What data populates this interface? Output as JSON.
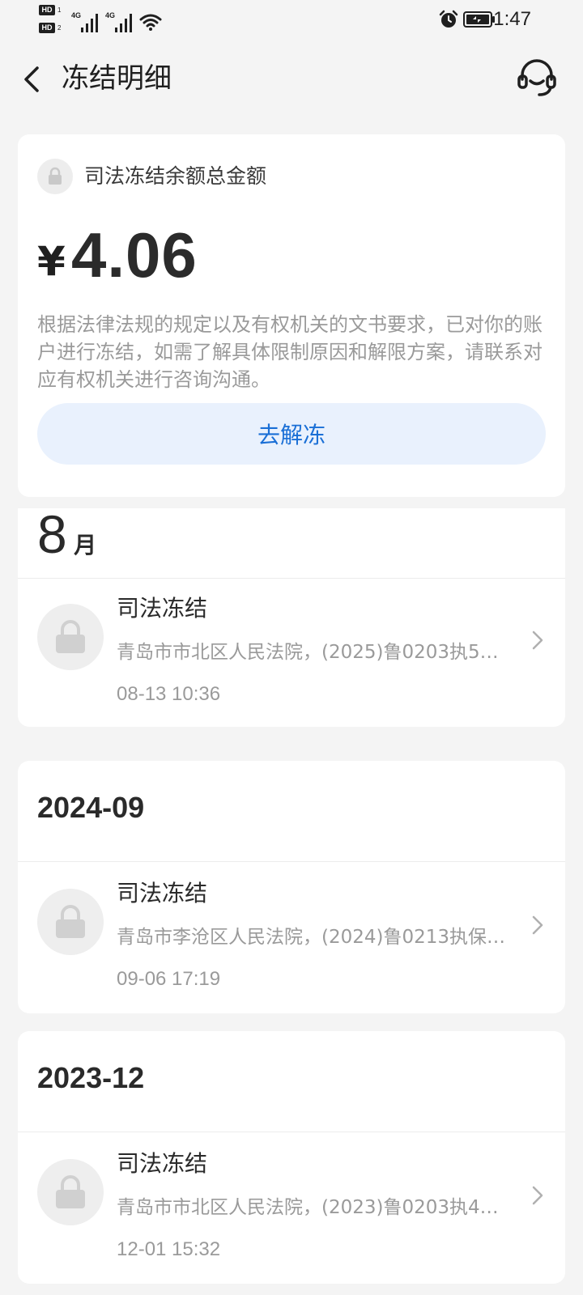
{
  "status_bar": {
    "hd1": "HD",
    "hd1_sub": "1",
    "hd2": "HD",
    "hd2_sub": "2",
    "net1": "4G",
    "net2": "4G",
    "time": "1:47"
  },
  "header": {
    "title": "冻结明细"
  },
  "summary": {
    "label": "司法冻结余额总金额",
    "currency": "¥",
    "amount": "4.06",
    "description": "根据法律法规的规定以及有权机关的文书要求，已对你的账户进行冻结，如需了解具体限制原因和解限方案，请联系对应有权机关进行咨询沟通。",
    "button": "去解冻"
  },
  "groups": [
    {
      "title_num": "8",
      "title_unit": "月",
      "records": [
        {
          "title": "司法冻结",
          "desc": "青岛市市北区人民法院，(2025)鲁0203执59…",
          "time": "08-13 10:36"
        }
      ]
    },
    {
      "title": "2024-09",
      "records": [
        {
          "title": "司法冻结",
          "desc": "青岛市李沧区人民法院，(2024)鲁0213执保…",
          "time": "09-06 17:19"
        }
      ]
    },
    {
      "title": "2023-12",
      "records": [
        {
          "title": "司法冻结",
          "desc": "青岛市市北区人民法院，(2023)鲁0203执41…",
          "time": "12-01 15:32"
        }
      ]
    }
  ],
  "colors": {
    "accent": "#1a6fd6",
    "button_bg": "#e9f1fd",
    "page_bg": "#f4f4f4"
  }
}
